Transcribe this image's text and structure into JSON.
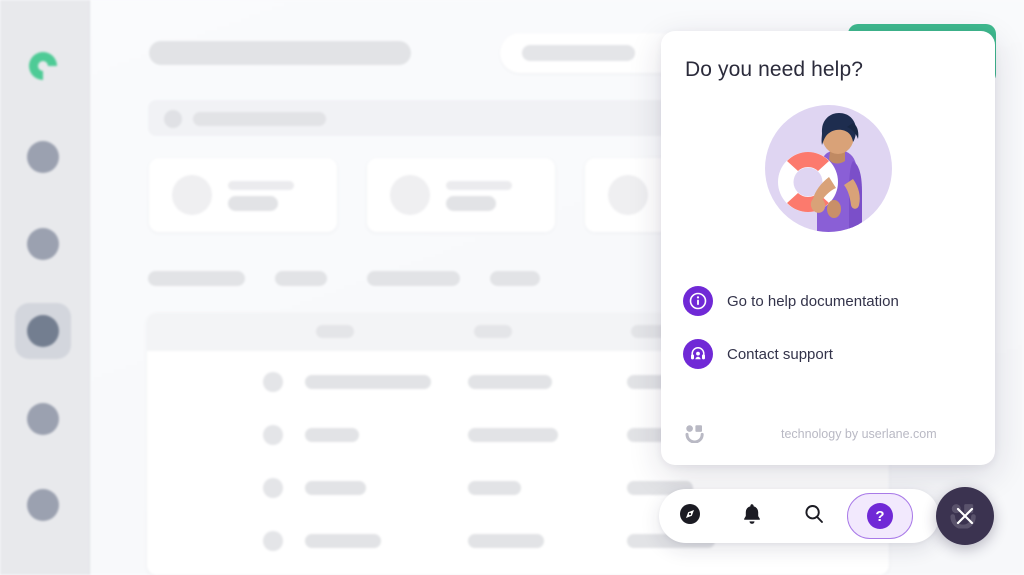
{
  "app": {
    "background_label": "blurred application behind overlay",
    "sidebar": {
      "logo_name": "green-c-logo",
      "items": [
        {
          "name": "nav-item-1",
          "active": false
        },
        {
          "name": "nav-item-2",
          "active": false
        },
        {
          "name": "nav-item-3",
          "active": true
        },
        {
          "name": "nav-item-4",
          "active": false
        },
        {
          "name": "nav-item-5",
          "active": false
        }
      ]
    }
  },
  "help_panel": {
    "title": "Do you need help?",
    "illustration_name": "person-holding-life-preserver",
    "items": [
      {
        "icon": "info-icon",
        "label": "Go to help documentation"
      },
      {
        "icon": "headset-support-icon",
        "label": "Contact support"
      }
    ],
    "footer": {
      "logo_name": "userlane-smiley-logo",
      "text": "technology by userlane.com"
    }
  },
  "toolbar": {
    "buttons": [
      {
        "icon": "compass-icon",
        "label": "Explore",
        "active": false
      },
      {
        "icon": "bell-icon",
        "label": "Notifications",
        "active": false
      },
      {
        "icon": "search-icon",
        "label": "Search",
        "active": false
      },
      {
        "icon": "question-mark-icon",
        "label": "Help",
        "active": true,
        "glyph": "?"
      }
    ],
    "close": {
      "icon": "close-x-icon",
      "label": "Close"
    }
  },
  "colors": {
    "accent_purple": "#7029d6",
    "help_pill_bg": "#f2e9fd",
    "help_pill_border": "#a97ae8",
    "close_button_bg": "#3b3350",
    "green_card": "#3fb98e",
    "logo_green": "#4ecb96",
    "sidebar_bg": "#e8e9ec",
    "panel_bg": "#ffffff",
    "title_text": "#2b2b3b",
    "footer_text": "#b9b9c4"
  }
}
